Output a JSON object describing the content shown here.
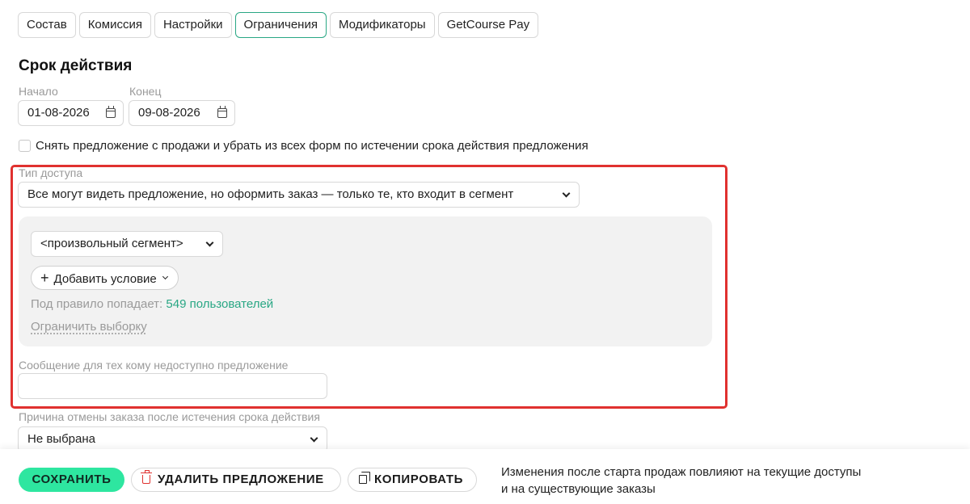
{
  "tabs": [
    {
      "label": "Состав",
      "active": false
    },
    {
      "label": "Комиссия",
      "active": false
    },
    {
      "label": "Настройки",
      "active": false
    },
    {
      "label": "Ограничения",
      "active": true
    },
    {
      "label": "Модификаторы",
      "active": false
    },
    {
      "label": "GetCourse Pay",
      "active": false
    }
  ],
  "validity": {
    "title": "Срок действия",
    "start_label": "Начало",
    "start_value": "01-08-2026",
    "end_label": "Конец",
    "end_value": "09-08-2026",
    "remove_checkbox_label": "Снять предложение с продажи и убрать из всех форм по истечении срока действия предложения",
    "remove_checked": false
  },
  "access": {
    "type_label": "Тип доступа",
    "type_value": "Все могут видеть предложение, но оформить заказ — только те, кто входит в сегмент",
    "segment_value": "<произвольный сегмент>",
    "add_condition_label": "Добавить условие",
    "rule_prefix": "Под правило попадает:",
    "rule_count": "549 пользователей",
    "limit_label": "Ограничить выборку",
    "message_label": "Сообщение для тех кому недоступно предложение",
    "message_value": ""
  },
  "cancel": {
    "label": "Причина отмены заказа после истечения срока действия",
    "value": "Не выбрана"
  },
  "footer": {
    "save_label": "СОХРАНИТЬ",
    "delete_label": "УДАЛИТЬ ПРЕДЛОЖЕНИЕ",
    "copy_label": "КОПИРОВАТЬ",
    "note_line1": "Изменения после старта продаж повлияют на текущие доступы",
    "note_line2": "и на существующие заказы"
  },
  "colors": {
    "accent": "#29a784",
    "save_button": "#2ee6a0",
    "highlight_frame": "#e0312f"
  },
  "icons": [
    "calendar-icon",
    "chevron-down-icon",
    "plus-icon",
    "trash-icon",
    "copy-icon"
  ]
}
